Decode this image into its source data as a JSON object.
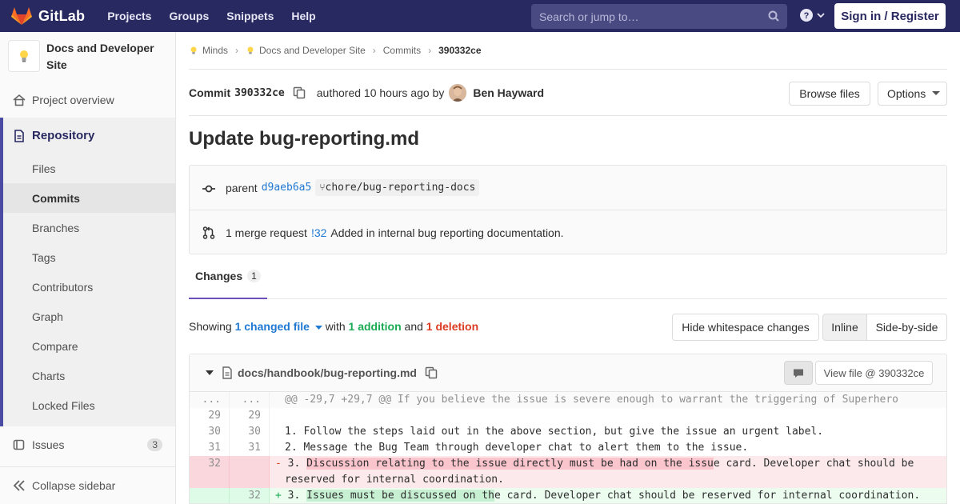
{
  "navbar": {
    "brand": "GitLab",
    "links": [
      "Projects",
      "Groups",
      "Snippets",
      "Help"
    ],
    "search_placeholder": "Search or jump to…",
    "signin": "Sign in / Register"
  },
  "sidebar": {
    "project_name_line1": "Docs and Developer",
    "project_name_line2": "Site",
    "overview": "Project overview",
    "repository": "Repository",
    "items": [
      "Files",
      "Commits",
      "Branches",
      "Tags",
      "Contributors",
      "Graph",
      "Compare",
      "Charts",
      "Locked Files"
    ],
    "active_item": "Commits",
    "issues": "Issues",
    "issues_count": "3",
    "collapse": "Collapse sidebar"
  },
  "breadcrumb": {
    "group": "Minds",
    "project": "Docs and Developer Site",
    "section": "Commits",
    "current": "390332ce"
  },
  "commit": {
    "label": "Commit",
    "sha": "390332ce",
    "authored": "authored 10 hours ago by",
    "author": "Ben Hayward",
    "browse_files": "Browse files",
    "options": "Options",
    "title": "Update bug-reporting.md",
    "parent_label": "parent",
    "parent_sha": "d9aeb6a5",
    "branch": "chore/bug-reporting-docs",
    "mr_text": "1 merge request",
    "mr_link": "!32",
    "mr_title": "Added in internal bug reporting documentation."
  },
  "tabs": {
    "changes_label": "Changes",
    "changes_count": "1"
  },
  "summary": {
    "showing": "Showing",
    "changed_files": "1 changed file",
    "with": "with",
    "additions": "1 addition",
    "and": "and",
    "deletions": "1 deletion",
    "hide_whitespace": "Hide whitespace changes",
    "inline": "Inline",
    "side_by_side": "Side-by-side"
  },
  "file": {
    "path": "docs/handbook/bug-reporting.md",
    "view_file": "View file @ 390332ce"
  },
  "diff": {
    "hunk": "@@ -29,7 +29,7 @@ If you believe the issue is severe enough to warrant the triggering of Superhero",
    "lines": [
      {
        "old": "29",
        "new": "29",
        "text": ""
      },
      {
        "old": "30",
        "new": "30",
        "text": "1. Follow the steps laid out in the above section, but give the issue an urgent label."
      },
      {
        "old": "31",
        "new": "31",
        "text": "2. Message the Bug Team through developer chat to alert them to the issue."
      }
    ],
    "del_num": "32",
    "del_prefix": "3. ",
    "del_hl": "Discussion relating to the issue directly must be had on the issu",
    "del_rest": "e card. Developer chat should be",
    "del_wrap": "reserved for internal coordination.",
    "add_num": "32",
    "add_prefix": "3. ",
    "add_hl": "Issues must be discussed on th",
    "add_rest": "e card. Developer chat should be reserved for internal coordination.",
    "ellipsis": "..."
  }
}
